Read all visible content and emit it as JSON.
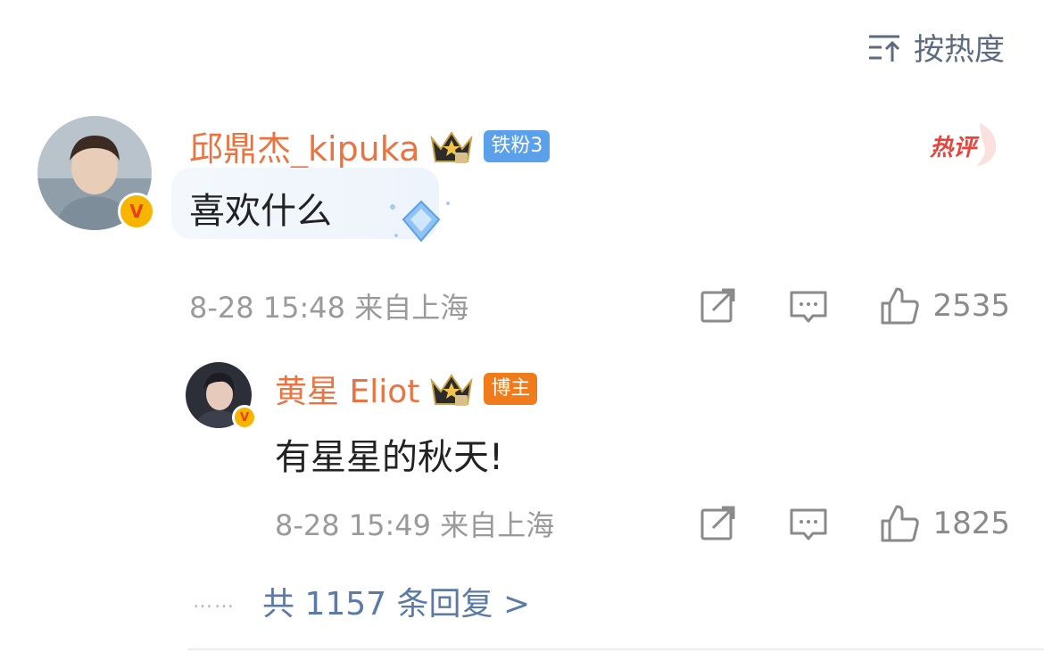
{
  "sort": {
    "label": "按热度"
  },
  "comments": [
    {
      "username": "邱鼎杰_kipuka",
      "level_tag": "铁粉3",
      "hot_tag": "热评",
      "content": "喜欢什么",
      "meta": "8-28 15:48 来自上海",
      "likes": "2535"
    }
  ],
  "reply": {
    "username": "黄星 Eliot",
    "tag": "博主",
    "content": "有星星的秋天!",
    "meta": "8-28 15:49 来自上海",
    "likes": "1825"
  },
  "more_replies": {
    "dots": "……",
    "label": "共 1157 条回复 >"
  },
  "colors": {
    "username": "#eb7340",
    "link": "#5b7aa8",
    "meta": "#9a9a9a",
    "verified_badge": "#f7b500"
  }
}
